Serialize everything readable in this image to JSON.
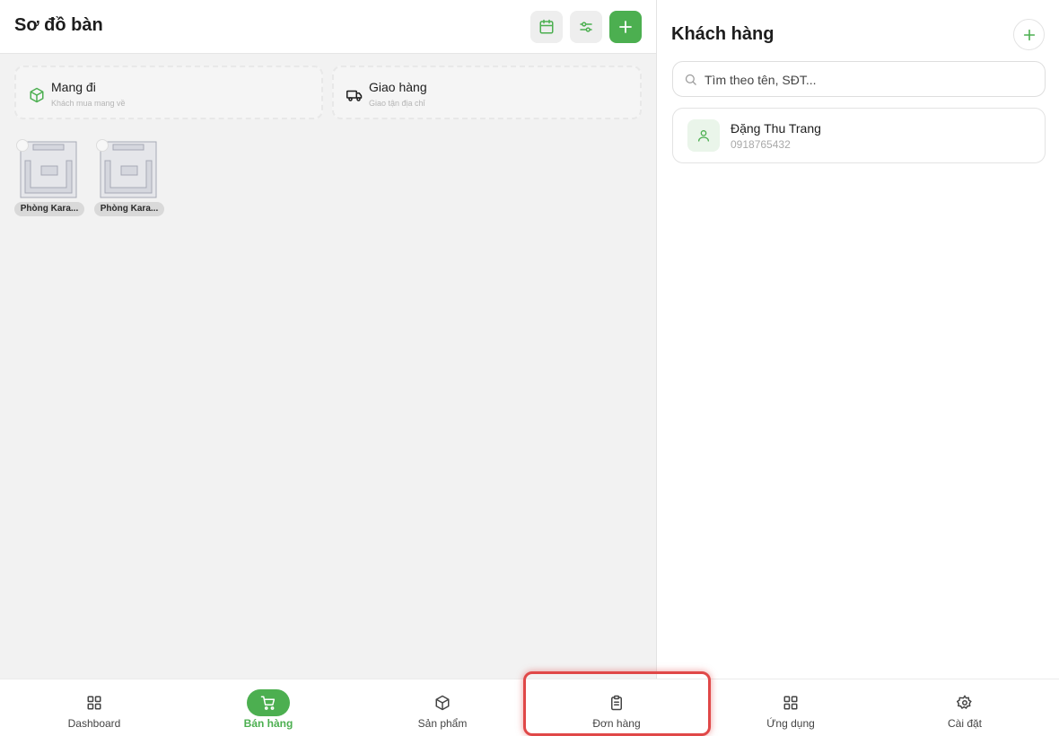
{
  "left_panel": {
    "title": "Sơ đồ bàn",
    "order_types": [
      {
        "title": "Mang đi",
        "subtitle": "Khách mua mang về",
        "icon": "package-icon"
      },
      {
        "title": "Giao hàng",
        "subtitle": "Giao tận địa chỉ",
        "icon": "truck-icon"
      }
    ],
    "rooms": [
      {
        "label": "Phòng Kara..."
      },
      {
        "label": "Phòng Kara..."
      }
    ]
  },
  "right_panel": {
    "title": "Khách hàng",
    "search": {
      "placeholder": "Tìm theo tên, SĐT..."
    },
    "customers": [
      {
        "name": "Đặng Thu Trang",
        "phone": "0918765432"
      }
    ]
  },
  "bottom_nav": {
    "items": [
      {
        "label": "Dashboard",
        "icon": "grid-icon",
        "active": false
      },
      {
        "label": "Bán hàng",
        "icon": "cart-icon",
        "active": true
      },
      {
        "label": "Sản phẩm",
        "icon": "box-icon",
        "active": false
      },
      {
        "label": "Đơn hàng",
        "icon": "clipboard-icon",
        "active": false
      },
      {
        "label": "Ứng dụng",
        "icon": "apps-icon",
        "active": false
      },
      {
        "label": "Cài đặt",
        "icon": "gear-icon",
        "active": false
      }
    ]
  },
  "colors": {
    "accent": "#4caf50",
    "highlight": "#e04848",
    "background": "#f2f2f2"
  }
}
